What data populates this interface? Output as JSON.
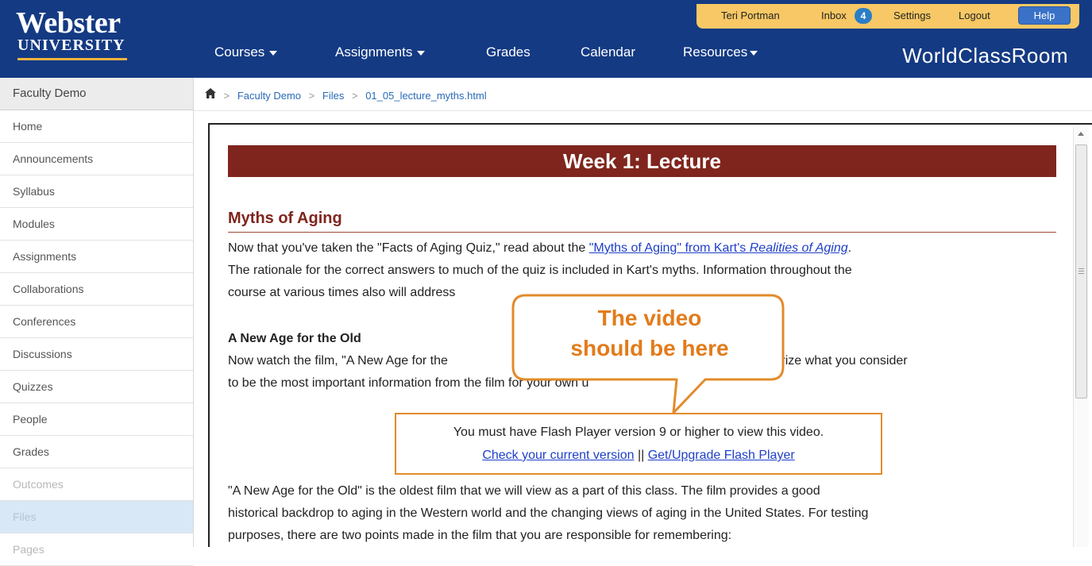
{
  "header": {
    "logo_name": "Webster",
    "logo_sub": "UNIVERSITY",
    "brand": "WorldClassRoom",
    "user_name": "Teri Portman",
    "inbox_label": "Inbox",
    "inbox_count": "4",
    "settings_label": "Settings",
    "logout_label": "Logout",
    "help_label": "Help",
    "nav": {
      "courses": "Courses",
      "assignments": "Assignments",
      "grades": "Grades",
      "calendar": "Calendar",
      "resources": "Resources"
    }
  },
  "sidebar": {
    "header": "Faculty Demo",
    "items": [
      {
        "label": "Home"
      },
      {
        "label": "Announcements"
      },
      {
        "label": "Syllabus"
      },
      {
        "label": "Modules"
      },
      {
        "label": "Assignments"
      },
      {
        "label": "Collaborations"
      },
      {
        "label": "Conferences"
      },
      {
        "label": "Discussions"
      },
      {
        "label": "Quizzes"
      },
      {
        "label": "People"
      },
      {
        "label": "Grades"
      },
      {
        "label": "Outcomes"
      },
      {
        "label": "Files"
      },
      {
        "label": "Pages"
      }
    ]
  },
  "breadcrumb": {
    "course": "Faculty Demo",
    "files": "Files",
    "file": "01_05_lecture_myths.html"
  },
  "content": {
    "banner": "Week 1: Lecture",
    "section_title": "Myths of Aging",
    "p1_start": "Now that you've taken the \"Facts of Aging Quiz,\" read about the ",
    "p1_link_a": "\"Myths of Aging\" from Kart's ",
    "p1_link_b": "Realities of Aging",
    "p1_end": ".",
    "p1_line2": "The rationale for the correct answers to much of the quiz is included in Kart's myths. Information throughout the",
    "p1_line3": "course at various times also will address",
    "sub_title": "A New Age for the Old",
    "p2_line1_a": "Now watch the film, \"A New Age for the",
    "p2_line1_b": "you to summarize what you consider",
    "p2_line2": "to be the most important information from the film for your own u",
    "flash_msg": "You must have Flash Player version 9 or higher to view this video.",
    "flash_link1": "Check your current version",
    "flash_sep": " || ",
    "flash_link2": "Get/Upgrade Flash Player",
    "p3_line1": "\"A New Age for the Old\" is the oldest film that we will view as a part of this class. The film provides a good",
    "p3_line2": "historical backdrop to aging in the Western world and the changing views of aging in the United States. For testing",
    "p3_line3": "purposes, there are two points made in the film that you are responsible for remembering:"
  },
  "callout": {
    "line1": "The video",
    "line2": "should be here"
  },
  "colors": {
    "header_bg": "#143a83",
    "accent_gold": "#f7c865",
    "banner_maroon": "#7f251d",
    "callout_orange": "#e38b2b",
    "link_blue": "#1f3fc8"
  }
}
